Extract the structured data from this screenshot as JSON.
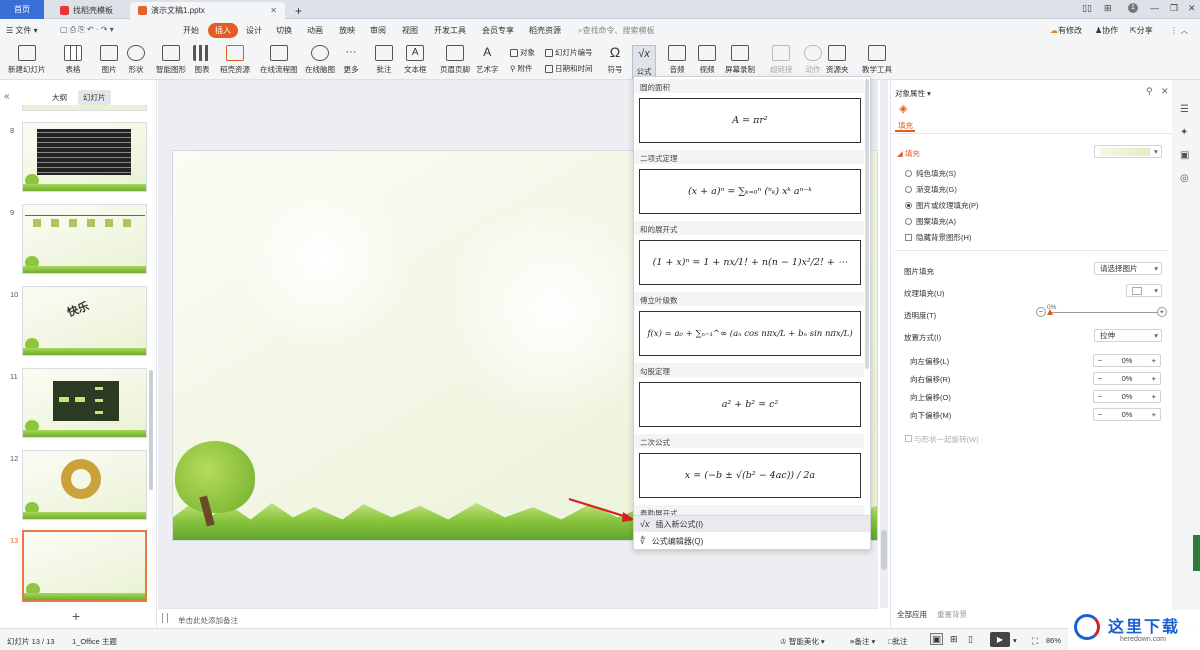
{
  "titlebar": {
    "tabs": [
      {
        "label": "首页"
      },
      {
        "label": "找稻壳模板"
      },
      {
        "label": "演示文稿1.pptx"
      }
    ],
    "new_tab": "+",
    "user_badge": "1"
  },
  "menubar": {
    "file": "文件",
    "items": [
      "开始",
      "插入",
      "设计",
      "切换",
      "动画",
      "放映",
      "审阅",
      "视图",
      "开发工具",
      "会员专享",
      "稻壳资源"
    ],
    "active": "插入",
    "search_placeholder": "查找命令、搜索模板",
    "right": {
      "edit": "有修改",
      "collab": "协作",
      "share": "分享"
    }
  },
  "ribbon": {
    "buttons": [
      "新建幻灯片",
      "表格",
      "图片",
      "形状",
      "智能图形",
      "图表",
      "稻壳资源",
      "在线流程图",
      "在线脑图",
      "更多",
      "批注",
      "文本框",
      "页眉页脚",
      "艺术字",
      "公式",
      "音频",
      "视频",
      "屏幕录制",
      "超链接",
      "动作",
      "资源夹",
      "教学工具"
    ],
    "small": {
      "object": "对象",
      "attach": "附件",
      "slide_num": "幻灯片编号",
      "datetime": "日期和时间",
      "symbol": "符号"
    }
  },
  "leftpanel": {
    "tabs": [
      "大纲",
      "幻灯片"
    ],
    "active_tab": "幻灯片",
    "slides": [
      8,
      9,
      10,
      11,
      12,
      13
    ],
    "selected_slide": 13,
    "slide10_text": "快乐",
    "add": "+"
  },
  "formula_dropdown": {
    "sections": [
      {
        "title": "圆的面积",
        "formula": "A = πr²"
      },
      {
        "title": "二项式定理",
        "formula": "(x + a)ⁿ = ∑ₖ₌₀ⁿ (ⁿₖ) xᵏ aⁿ⁻ᵏ"
      },
      {
        "title": "和的展开式",
        "formula": "(1 + x)ⁿ = 1 + nx/1! + n(n − 1)x²/2! + ⋯"
      },
      {
        "title": "傅立叶级数",
        "formula": "f(x) = a₀ + ∑ₙ₌₁^∞ (aₙ cos nπx/L + bₙ sin nπx/L)"
      },
      {
        "title": "勾股定理",
        "formula": "a² + b² = c²"
      },
      {
        "title": "二次公式",
        "formula": "x = (−b ± √(b² − 4ac)) / 2a"
      }
    ],
    "partial_section": "泰勒展开式",
    "actions": [
      {
        "label": "插入新公式(I)",
        "icon": "formula-icon"
      },
      {
        "label": "公式编辑器(Q)",
        "icon": "formula-editor-icon"
      }
    ]
  },
  "rightpanel": {
    "title": "对象属性",
    "fill_tab": "填充",
    "fill_section": "填充",
    "fill_options": [
      {
        "label": "纯色填充(S)",
        "checked": false
      },
      {
        "label": "渐变填充(G)",
        "checked": false
      },
      {
        "label": "图片或纹理填充(P)",
        "checked": true
      },
      {
        "label": "图案填充(A)",
        "checked": false
      }
    ],
    "hide_bg": "隐藏背景图形(H)",
    "picture_fill": {
      "label": "图片填充",
      "value": "请选择图片"
    },
    "texture_fill": {
      "label": "纹理填充(U)"
    },
    "transparency": {
      "label": "透明度(T)",
      "value": "0%"
    },
    "placement": {
      "label": "放置方式(I)",
      "value": "拉伸"
    },
    "offsets": [
      {
        "label": "向左偏移(L)",
        "value": "0%"
      },
      {
        "label": "向右偏移(R)",
        "value": "0%"
      },
      {
        "label": "向上偏移(O)",
        "value": "0%"
      },
      {
        "label": "向下偏移(M)",
        "value": "0%"
      }
    ],
    "rotate_with_shape": "与形状一起旋转(W)",
    "apply_all": "全部应用",
    "reset_bg": "重置背景"
  },
  "notes": {
    "placeholder": "单击此处添加备注"
  },
  "statusbar": {
    "slide_info": "幻灯片 13 / 13",
    "theme": "1_Office 主题",
    "beautify": "智能美化",
    "notes": "备注",
    "comments": "批注",
    "zoom": "86%"
  },
  "watermark": {
    "title": "这里下载",
    "url": "heredown.com"
  },
  "colors": {
    "accent": "#e55b22",
    "home_tab": "#3b6fd8",
    "link": "#1a5fd0"
  }
}
